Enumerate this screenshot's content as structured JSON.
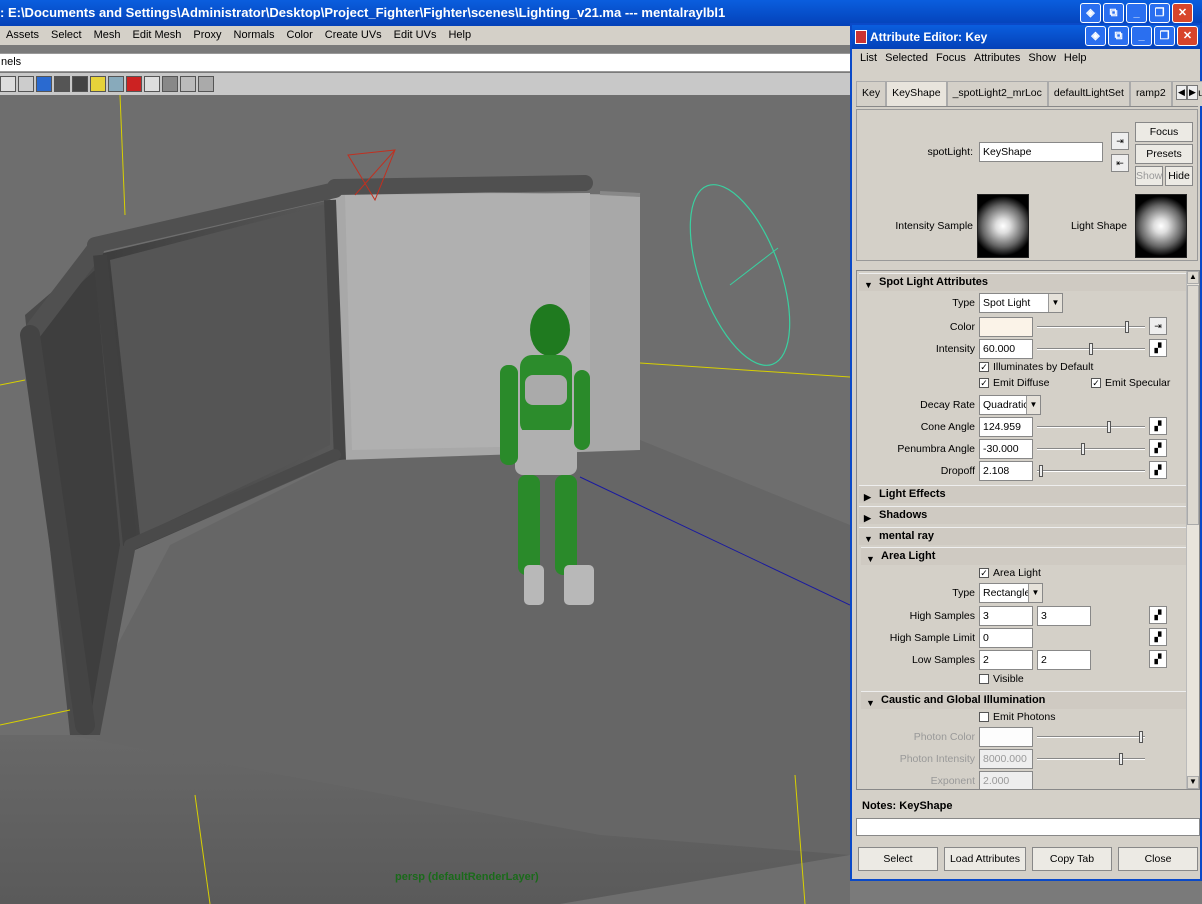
{
  "main": {
    "title": ": E:\\Documents and Settings\\Administrator\\Desktop\\Project_Fighter\\Fighter\\scenes\\Lighting_v21.ma   ---   mentalraylbl1",
    "menu": [
      "Assets",
      "Select",
      "Mesh",
      "Edit Mesh",
      "Proxy",
      "Normals",
      "Color",
      "Create UVs",
      "Edit UVs",
      "Help"
    ],
    "channels_text": "nels",
    "viewport_label": "persp (defaultRenderLayer)"
  },
  "ae": {
    "title": "Attribute Editor: Key",
    "menu": [
      "List",
      "Selected",
      "Focus",
      "Attributes",
      "Show",
      "Help"
    ],
    "tabs": [
      "Key",
      "KeyShape",
      "_spotLight2_mrLoc",
      "defaultLightSet",
      "ramp2",
      "defaultRenc"
    ],
    "header": {
      "node_label": "spotLight:",
      "node_value": "KeyShape",
      "focus": "Focus",
      "presets": "Presets",
      "show": "Show",
      "hide": "Hide",
      "intensity_sample": "Intensity Sample",
      "light_shape": "Light Shape"
    },
    "spot": {
      "title": "Spot Light Attributes",
      "type_label": "Type",
      "type_value": "Spot Light",
      "color_label": "Color",
      "color_value": "#fbf3e8",
      "intensity_label": "Intensity",
      "intensity_value": "60.000",
      "intensity_level": 0.45,
      "illum_default": "Illuminates by Default",
      "emit_diffuse": "Emit Diffuse",
      "emit_specular": "Emit Specular",
      "decay_label": "Decay Rate",
      "decay_value": "Quadratic",
      "cone_label": "Cone Angle",
      "cone_value": "124.959",
      "penumbra_label": "Penumbra Angle",
      "penumbra_value": "-30.000",
      "dropoff_label": "Dropoff",
      "dropoff_value": "2.108"
    },
    "sections": {
      "light_effects": "Light Effects",
      "shadows": "Shadows",
      "mental_ray": "mental ray",
      "area_light": "Area Light",
      "caustic": "Caustic and Global Illumination"
    },
    "area": {
      "area_light": "Area Light",
      "type_label": "Type",
      "type_value": "Rectangle",
      "high_samples_label": "High Samples",
      "high_samples_1": "3",
      "high_samples_2": "3",
      "hsl_label": "High Sample Limit",
      "hsl_value": "0",
      "low_samples_label": "Low Samples",
      "low_samples_1": "2",
      "low_samples_2": "2",
      "visible": "Visible"
    },
    "caustic": {
      "emit_photons": "Emit Photons",
      "photon_color": "Photon Color",
      "photon_intensity": "Photon Intensity",
      "photon_intensity_value": "8000.000",
      "exponent": "Exponent",
      "exponent_value": "2.000"
    },
    "notes_label": "Notes:  KeyShape",
    "buttons": [
      "Select",
      "Load Attributes",
      "Copy Tab",
      "Close"
    ]
  }
}
